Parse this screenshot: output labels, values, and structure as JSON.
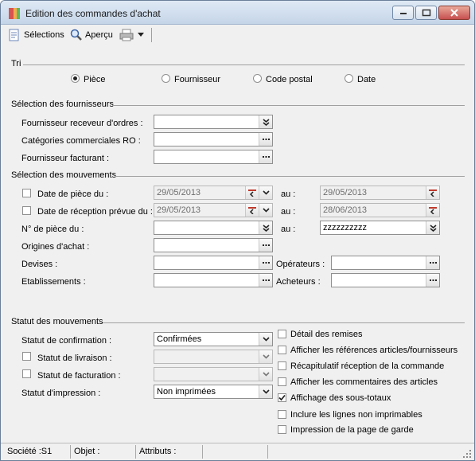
{
  "window": {
    "title": "Edition des commandes d'achat"
  },
  "toolbar": {
    "selections_label": "Sélections",
    "apercu_label": "Aperçu"
  },
  "tri": {
    "title": "Tri",
    "options": [
      {
        "label": "Pièce",
        "selected": true
      },
      {
        "label": "Fournisseur",
        "selected": false
      },
      {
        "label": "Code postal",
        "selected": false
      },
      {
        "label": "Date",
        "selected": false
      }
    ]
  },
  "fournisseurs": {
    "title": "Sélection des fournisseurs",
    "receveur_label": "Fournisseur receveur d'ordres :",
    "categories_label": "Catégories commerciales RO :",
    "facturant_label": "Fournisseur facturant :",
    "receveur_value": "",
    "categories_value": "",
    "facturant_value": ""
  },
  "mouvements": {
    "title": "Sélection des mouvements",
    "date_piece_label": "Date de pièce du :",
    "date_piece_from": "29/05/2013",
    "date_piece_to": "29/05/2013",
    "date_reception_label": "Date de réception prévue du :",
    "date_reception_from": "29/05/2013",
    "date_reception_to": "28/06/2013",
    "au_label": "au :",
    "num_piece_label": "N° de pièce du :",
    "num_piece_from": "",
    "num_piece_to": "zzzzzzzzzz",
    "origines_label": "Origines d'achat :",
    "devises_label": "Devises :",
    "etablissements_label": "Etablissements :",
    "operateurs_label": "Opérateurs :",
    "acheteurs_label": "Acheteurs :"
  },
  "statut": {
    "title": "Statut des mouvements",
    "confirmation_label": "Statut de confirmation :",
    "confirmation_value": "Confirmées",
    "livraison_label": "Statut de livraison :",
    "facturation_label": "Statut de facturation :",
    "impression_label": "Statut d'impression :",
    "impression_value": "Non imprimées",
    "options": [
      {
        "label": "Détail des remises",
        "checked": false
      },
      {
        "label": "Afficher les références articles/fournisseurs",
        "checked": false
      },
      {
        "label": "Récapitulatif réception de la commande",
        "checked": false
      },
      {
        "label": "Afficher les commentaires des articles",
        "checked": false
      },
      {
        "label": "Affichage des sous-totaux",
        "checked": true
      },
      {
        "label": "Inclure les lignes non imprimables",
        "checked": false
      },
      {
        "label": "Impression de la page de garde",
        "checked": false
      }
    ]
  },
  "statusbar": {
    "societe": "Société :S1",
    "objet": "Objet :",
    "attributs": "Attributs :"
  }
}
